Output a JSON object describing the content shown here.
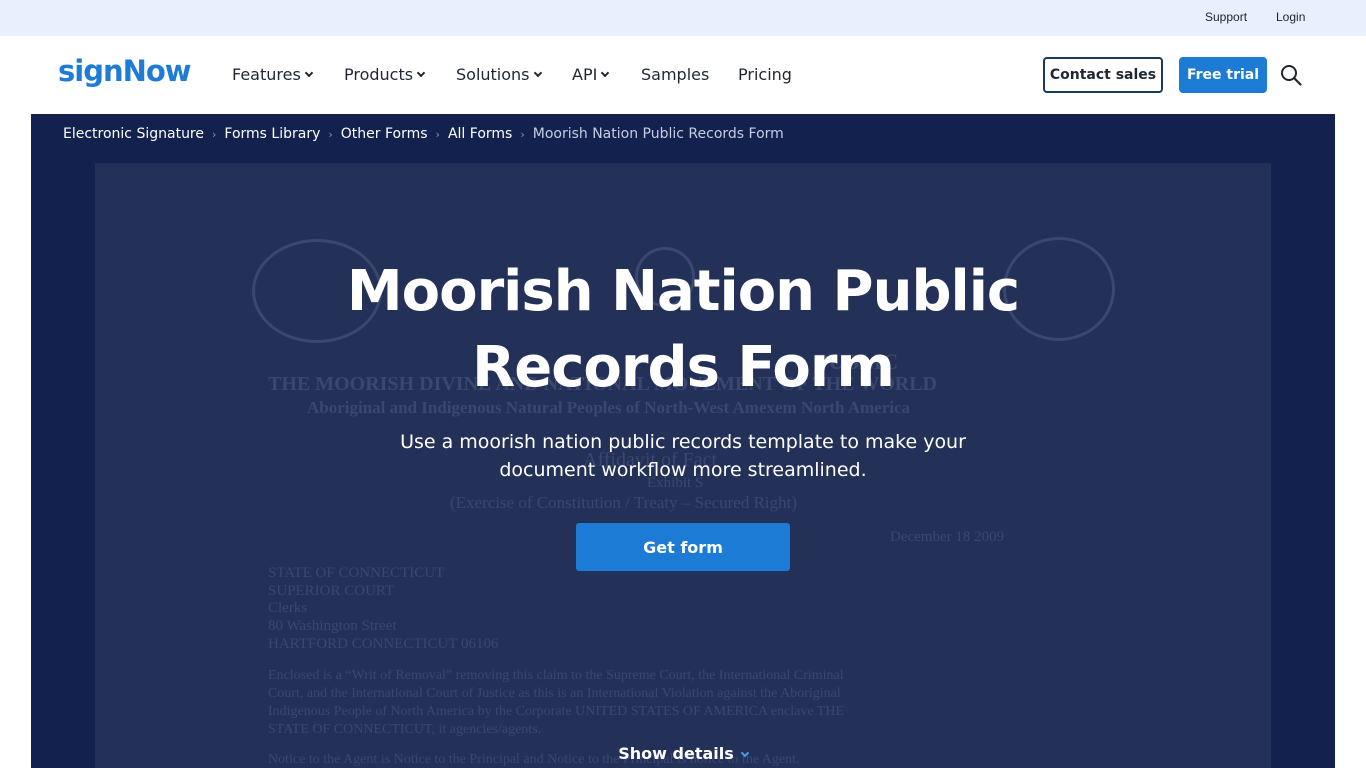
{
  "topbar": {
    "support": "Support",
    "login": "Login"
  },
  "brand": {
    "logo": "signNow",
    "accent": "#1c7bd5"
  },
  "nav": {
    "items": [
      {
        "label": "Features",
        "has_dropdown": true
      },
      {
        "label": "Products",
        "has_dropdown": true
      },
      {
        "label": "Solutions",
        "has_dropdown": true
      },
      {
        "label": "API",
        "has_dropdown": true
      },
      {
        "label": "Samples",
        "has_dropdown": false
      },
      {
        "label": "Pricing",
        "has_dropdown": false
      }
    ],
    "contact_sales": "Contact sales",
    "free_trial": "Free trial",
    "search_icon": "search-icon"
  },
  "breadcrumb": {
    "items": [
      "Electronic Signature",
      "Forms Library",
      "Other Forms",
      "All Forms"
    ],
    "current": "Moorish Nation Public Records Form"
  },
  "hero": {
    "title_line1": "Moorish Nation Public",
    "title_line2": "Records Form",
    "subtitle_line1": "Use a moorish nation public records template to make your",
    "subtitle_line2": "document workflow more streamlined.",
    "cta": "Get form",
    "show_details": "Show details",
    "background": "#13214f"
  },
  "document_preview": {
    "lines": [
      "PUBLIC",
      "THE MOORISH DIVINE AND NATIONAL MOVEMENT OF THE WORLD",
      "Aboriginal and Indigenous Natural Peoples of North-West Amexem North America",
      "Affidavit of Fact",
      "Exhibit S",
      "(Exercise of Constitution / Treaty – Secured Right)",
      "December 18 2009",
      "STATE OF CONNECTICUT",
      "SUPERIOR COURT",
      "Clerks",
      "80 Washington Street",
      "HARTFORD CONNECTICUT 06106",
      "Enclosed is a “Writ of Removal” removing this claim to the Supreme Court, the International Criminal",
      "Court, and the International Court of Justice as this is an International Violation against the Aboriginal",
      "Indigenous People of North America by the Corporate UNITED STATES OF AMERICA enclave THE",
      "STATE OF CONNECTICUT, it agencies/agents.",
      "Notice to the Agent is Notice to the Principal and Notice to the Principal is notice to the Agent."
    ]
  }
}
